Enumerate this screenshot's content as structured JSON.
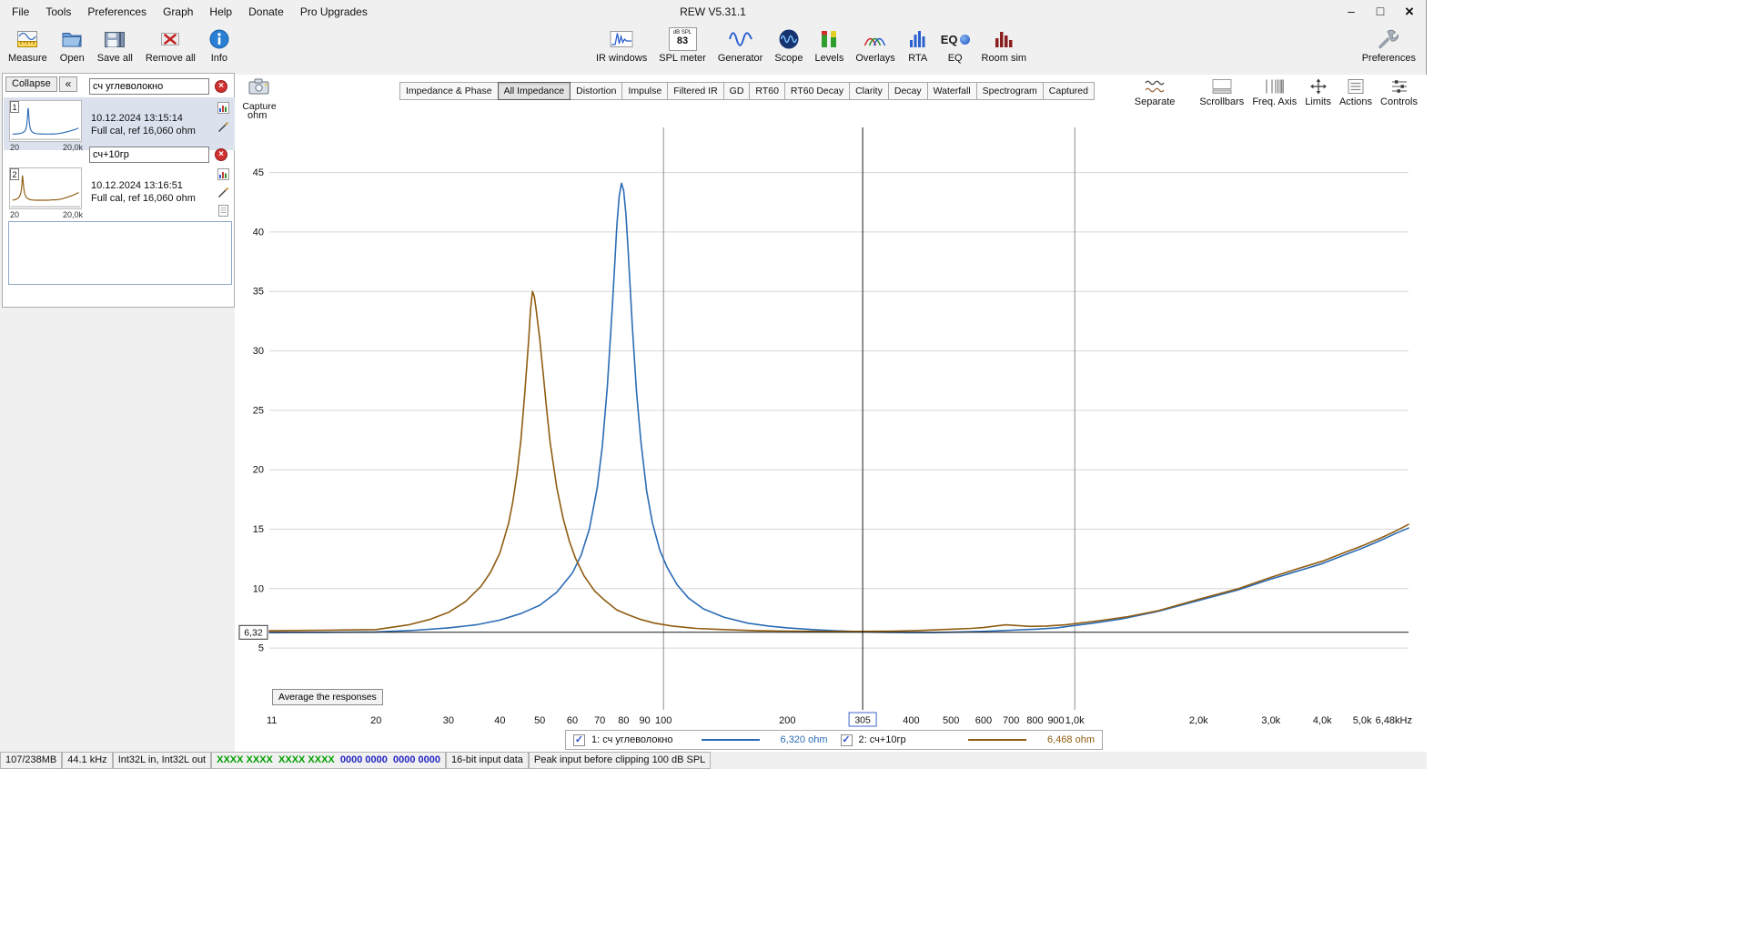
{
  "titlebar": {
    "title": "REW V5.31.1",
    "minimize_glyph": "–",
    "maximize_glyph": "□",
    "close_glyph": "×"
  },
  "menu": {
    "items": [
      "File",
      "Tools",
      "Preferences",
      "Graph",
      "Help",
      "Donate",
      "Pro Upgrades"
    ]
  },
  "icons": {
    "check_glyph": "✓",
    "collapse_glyph": "«",
    "delete_glyph": "×"
  },
  "toolbar": {
    "measure": "Measure",
    "open": "Open",
    "save_all": "Save all",
    "remove_all": "Remove all",
    "info": "Info",
    "ir_windows": "IR windows",
    "spl_meter": "SPL meter",
    "spl_units": "dB SPL",
    "spl_value": "83",
    "generator": "Generator",
    "scope": "Scope",
    "levels": "Levels",
    "overlays": "Overlays",
    "rta": "RTA",
    "eq": "EQ",
    "room_sim": "Room sim",
    "preferences": "Preferences"
  },
  "graph_toolbar": {
    "separate": "Separate",
    "scrollbars": "Scrollbars",
    "freq_axis": "Freq. Axis",
    "limits": "Limits",
    "actions": "Actions",
    "controls": "Controls"
  },
  "tabs": {
    "items": [
      "Impedance & Phase",
      "All Impedance",
      "Distortion",
      "Impulse",
      "Filtered IR",
      "GD",
      "RT60",
      "RT60 Decay",
      "Clarity",
      "Decay",
      "Waterfall",
      "Spectrogram",
      "Captured"
    ],
    "selected": "All Impedance"
  },
  "left_panel": {
    "collapse_label": "Collapse",
    "measurements": [
      {
        "num": "1",
        "name": "сч углеволокно",
        "date": "10.12.2024 13:15:14",
        "cal": "Full cal, ref 16,060 ohm",
        "thumb_min": "20",
        "thumb_max": "20,0k"
      },
      {
        "num": "2",
        "name": "сч+10гр",
        "date": "10.12.2024 13:16:51",
        "cal": "Full cal, ref 16,060 ohm",
        "thumb_min": "20",
        "thumb_max": "20,0k"
      }
    ]
  },
  "graph": {
    "capture_label": "Capture",
    "unit_label": "ohm",
    "average_button": "Average the responses"
  },
  "legend": {
    "items": [
      {
        "label": "1: сч углеволокно",
        "value": "6,320 ohm",
        "color": "#2b6cb5"
      },
      {
        "label": "2: сч+10гр",
        "value": "6,468 ohm",
        "color": "#8f5c10"
      }
    ]
  },
  "statusbar": {
    "memory": "107/238MB",
    "sample_rate": "44.1 kHz",
    "io_format": "Int32L in, Int32L out",
    "ch_green_1": "XXXX XXXX",
    "ch_green_2": "XXXX XXXX",
    "ch_blue_1": "0000 0000",
    "ch_blue_2": "0000 0000",
    "bit_depth": "16-bit input data",
    "peak": "Peak input before clipping 100 dB SPL"
  },
  "chart_data": {
    "type": "line",
    "title": "All Impedance",
    "xlabel": "Hz",
    "ylabel": "ohm",
    "x_scale": "log",
    "xlim": [
      11,
      6480
    ],
    "ylim": [
      -0.2,
      48.8
    ],
    "grid": true,
    "legend_position": "bottom",
    "y_ticks": [
      5,
      10,
      15,
      20,
      25,
      30,
      35,
      40,
      45
    ],
    "x_ticks": [
      {
        "f": 11,
        "label": "11"
      },
      {
        "f": 20,
        "label": "20"
      },
      {
        "f": 30,
        "label": "30"
      },
      {
        "f": 40,
        "label": "40"
      },
      {
        "f": 50,
        "label": "50"
      },
      {
        "f": 60,
        "label": "60"
      },
      {
        "f": 70,
        "label": "70"
      },
      {
        "f": 80,
        "label": "80"
      },
      {
        "f": 90,
        "label": "90"
      },
      {
        "f": 100,
        "label": "100"
      },
      {
        "f": 200,
        "label": "200"
      },
      {
        "f": 400,
        "label": "400"
      },
      {
        "f": 500,
        "label": "500"
      },
      {
        "f": 600,
        "label": "600"
      },
      {
        "f": 700,
        "label": "700"
      },
      {
        "f": 800,
        "label": "800"
      },
      {
        "f": 900,
        "label": "900"
      },
      {
        "f": 1000,
        "label": "1,0k"
      },
      {
        "f": 2000,
        "label": "2,0k"
      },
      {
        "f": 3000,
        "label": "3,0k"
      },
      {
        "f": 4000,
        "label": "4,0k"
      },
      {
        "f": 5000,
        "label": "5,0k"
      },
      {
        "f": 6480,
        "label": "6,48kHz"
      }
    ],
    "major_vlines": [
      100,
      1000
    ],
    "cursor": {
      "freq": 305,
      "freq_label": "305",
      "ohm": 6.32,
      "ohm_label": "6,32"
    },
    "series": [
      {
        "name": "1: сч углеволокно",
        "color": "#2b6cb5",
        "points": [
          [
            11,
            6.3
          ],
          [
            15,
            6.32
          ],
          [
            20,
            6.35
          ],
          [
            25,
            6.5
          ],
          [
            30,
            6.7
          ],
          [
            35,
            6.95
          ],
          [
            40,
            7.35
          ],
          [
            45,
            7.9
          ],
          [
            50,
            8.6
          ],
          [
            55,
            9.7
          ],
          [
            60,
            11.3
          ],
          [
            63,
            12.8
          ],
          [
            66,
            15
          ],
          [
            69,
            18.5
          ],
          [
            71,
            22
          ],
          [
            73,
            27
          ],
          [
            75,
            33.5
          ],
          [
            76,
            37
          ],
          [
            77,
            40.5
          ],
          [
            78,
            43
          ],
          [
            79,
            44.1
          ],
          [
            80,
            43.5
          ],
          [
            81,
            41.5
          ],
          [
            82,
            38.5
          ],
          [
            84,
            32
          ],
          [
            86,
            26.5
          ],
          [
            88,
            22.5
          ],
          [
            91,
            18.2
          ],
          [
            94,
            15.5
          ],
          [
            98,
            13.2
          ],
          [
            102,
            11.8
          ],
          [
            108,
            10.3
          ],
          [
            115,
            9.2
          ],
          [
            125,
            8.3
          ],
          [
            140,
            7.6
          ],
          [
            160,
            7.1
          ],
          [
            180,
            6.85
          ],
          [
            200,
            6.7
          ],
          [
            230,
            6.55
          ],
          [
            260,
            6.45
          ],
          [
            300,
            6.38
          ],
          [
            350,
            6.32
          ],
          [
            400,
            6.3
          ],
          [
            450,
            6.3
          ],
          [
            500,
            6.33
          ],
          [
            600,
            6.4
          ],
          [
            700,
            6.5
          ],
          [
            800,
            6.58
          ],
          [
            900,
            6.68
          ],
          [
            1000,
            6.9
          ],
          [
            1100,
            7.08
          ],
          [
            1300,
            7.45
          ],
          [
            1600,
            8.1
          ],
          [
            2000,
            9.0
          ],
          [
            2500,
            9.9
          ],
          [
            3000,
            10.8
          ],
          [
            3500,
            11.5
          ],
          [
            4000,
            12.1
          ],
          [
            4500,
            12.8
          ],
          [
            5000,
            13.4
          ],
          [
            5500,
            14.0
          ],
          [
            6000,
            14.6
          ],
          [
            6480,
            15.1
          ]
        ]
      },
      {
        "name": "2: сч+10гр",
        "color": "#8f5c10",
        "points": [
          [
            11,
            6.45
          ],
          [
            15,
            6.5
          ],
          [
            20,
            6.55
          ],
          [
            24,
            6.95
          ],
          [
            27,
            7.4
          ],
          [
            30,
            8.0
          ],
          [
            33,
            8.9
          ],
          [
            36,
            10.2
          ],
          [
            38,
            11.4
          ],
          [
            40,
            13.0
          ],
          [
            42,
            15.5
          ],
          [
            43,
            17.3
          ],
          [
            44,
            19.6
          ],
          [
            45,
            22.5
          ],
          [
            46,
            26.5
          ],
          [
            47,
            31
          ],
          [
            47.5,
            33.5
          ],
          [
            48,
            35
          ],
          [
            48.5,
            34.6
          ],
          [
            49,
            33.5
          ],
          [
            50,
            31
          ],
          [
            51,
            28
          ],
          [
            52,
            25
          ],
          [
            53,
            22.3
          ],
          [
            55,
            18.5
          ],
          [
            57,
            15.9
          ],
          [
            59,
            14
          ],
          [
            61,
            12.6
          ],
          [
            64,
            11.1
          ],
          [
            68,
            9.8
          ],
          [
            72,
            9.0
          ],
          [
            77,
            8.2
          ],
          [
            82,
            7.8
          ],
          [
            88,
            7.4
          ],
          [
            95,
            7.1
          ],
          [
            105,
            6.85
          ],
          [
            120,
            6.65
          ],
          [
            140,
            6.55
          ],
          [
            170,
            6.45
          ],
          [
            200,
            6.42
          ],
          [
            250,
            6.4
          ],
          [
            300,
            6.4
          ],
          [
            360,
            6.42
          ],
          [
            420,
            6.48
          ],
          [
            500,
            6.58
          ],
          [
            560,
            6.65
          ],
          [
            600,
            6.72
          ],
          [
            640,
            6.85
          ],
          [
            680,
            6.95
          ],
          [
            720,
            6.9
          ],
          [
            780,
            6.82
          ],
          [
            850,
            6.85
          ],
          [
            950,
            6.95
          ],
          [
            1000,
            7.05
          ],
          [
            1150,
            7.3
          ],
          [
            1350,
            7.65
          ],
          [
            1600,
            8.15
          ],
          [
            2000,
            9.1
          ],
          [
            2500,
            10.0
          ],
          [
            3000,
            10.95
          ],
          [
            3500,
            11.7
          ],
          [
            4000,
            12.3
          ],
          [
            4500,
            13.0
          ],
          [
            5000,
            13.6
          ],
          [
            5500,
            14.2
          ],
          [
            6000,
            14.8
          ],
          [
            6480,
            15.4
          ]
        ]
      }
    ]
  }
}
